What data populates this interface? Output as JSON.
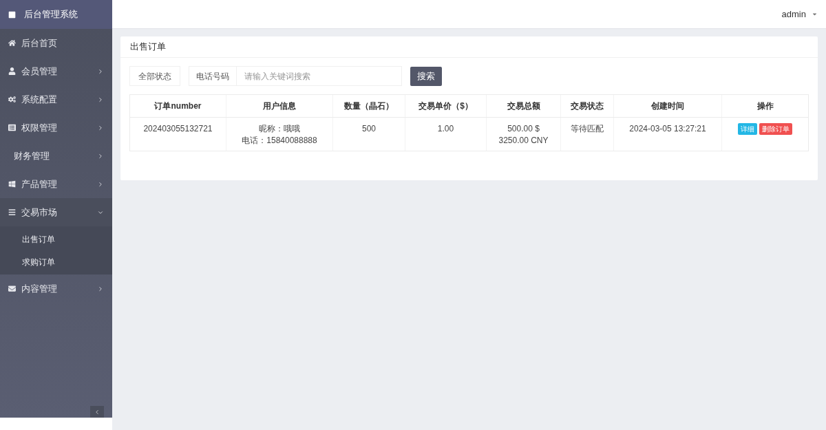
{
  "brand": "后台管理系统",
  "sidebar": {
    "items": [
      {
        "label": "后台首页",
        "kind": "link",
        "expanded": false
      },
      {
        "label": "会员管理",
        "kind": "menu",
        "expanded": false
      },
      {
        "label": "系统配置",
        "kind": "menu",
        "expanded": false
      },
      {
        "label": "权限管理",
        "kind": "menu",
        "expanded": false
      },
      {
        "label": "财务管理",
        "kind": "menu",
        "expanded": false
      },
      {
        "label": "产品管理",
        "kind": "menu",
        "expanded": false
      },
      {
        "label": "交易市场",
        "kind": "menu",
        "expanded": true,
        "children": [
          {
            "label": "出售订单"
          },
          {
            "label": "求购订单"
          }
        ]
      },
      {
        "label": "内容管理",
        "kind": "menu",
        "expanded": false
      }
    ]
  },
  "user": "admin",
  "panel": {
    "title": "出售订单",
    "filters": {
      "status": "全部状态",
      "field_label": "电话号码",
      "placeholder": "请输入关键词搜索",
      "button": "搜索"
    },
    "table": {
      "columns": [
        "订单number",
        "用户信息",
        "数量（晶石）",
        "交易单价（$）",
        "交易总额",
        "交易状态",
        "创建时间",
        "操作"
      ],
      "rows": [
        {
          "order": "202403055132721",
          "user": [
            "昵称：哦哦",
            "电话：15840088888"
          ],
          "quantity": "500",
          "price": "1.00",
          "total": [
            "500.00 $",
            "3250.00 CNY"
          ],
          "status": "等待匹配",
          "created": "2024-03-05 13:27:21",
          "actions": [
            "详细",
            "删除订单"
          ]
        }
      ]
    }
  }
}
